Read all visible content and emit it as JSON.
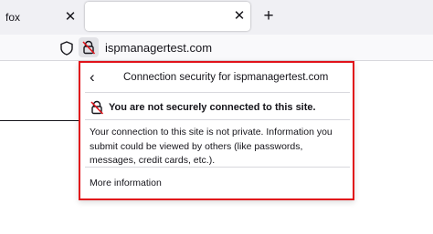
{
  "tabs": {
    "previous_tab_label": "fox",
    "close_glyph": "✕",
    "new_tab_glyph": "+"
  },
  "navbar": {
    "url": "ispmanagertest.com",
    "tracking_icon": "shield-icon",
    "security_icon": "broken-lock-icon"
  },
  "popup": {
    "back_glyph": "‹",
    "title": "Connection security for ispmanagertest.com",
    "warning": "You are not securely connected to this site.",
    "description": "Your connection to this site is not private. Information you submit could be viewed by others (like passwords, messages, credit cards, etc.).",
    "more_info": "More information",
    "highlight_color": "#e1121a",
    "warning_icon": "broken-lock-icon"
  }
}
